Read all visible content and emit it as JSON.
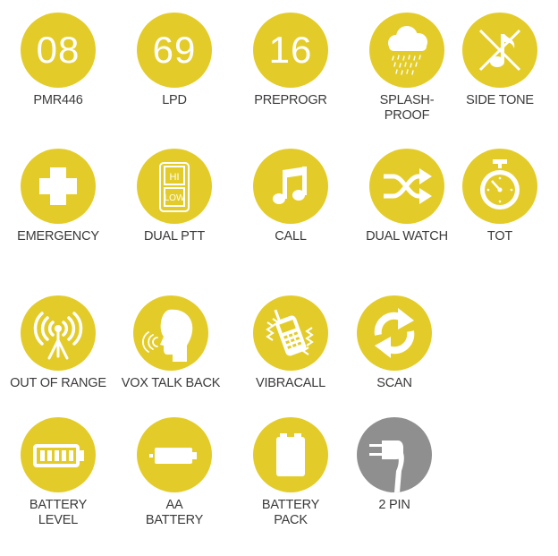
{
  "colors": {
    "accent": "#e3cc2a",
    "neutral": "#8f8f90",
    "icon": "#ffffff",
    "label": "#3a3a3a"
  },
  "features": [
    {
      "id": "pmr446",
      "number": "08",
      "label_lines": [
        "PMR446"
      ]
    },
    {
      "id": "lpd",
      "number": "69",
      "label_lines": [
        "LPD"
      ]
    },
    {
      "id": "preprogr",
      "number": "16",
      "label_lines": [
        "PREPROGR"
      ]
    },
    {
      "id": "splash-proof",
      "icon": "rain-cloud-icon",
      "label_lines": [
        "SPLASH-",
        "PROOF"
      ]
    },
    {
      "id": "side-tone",
      "icon": "muted-note-icon",
      "label_lines": [
        "SIDE TONE"
      ]
    },
    {
      "id": "emergency",
      "icon": "cross-icon",
      "label_lines": [
        "EMERGENCY"
      ]
    },
    {
      "id": "dual-ptt",
      "icon": "hi-low-switch-icon",
      "switch_top": "HI",
      "switch_bottom": "LOW",
      "label_lines": [
        "DUAL PTT"
      ]
    },
    {
      "id": "call",
      "icon": "music-note-icon",
      "label_lines": [
        "CALL"
      ]
    },
    {
      "id": "dual-watch",
      "icon": "shuffle-icon",
      "label_lines": [
        "DUAL WATCH"
      ]
    },
    {
      "id": "tot",
      "icon": "stopwatch-icon",
      "label_lines": [
        "TOT"
      ]
    },
    {
      "id": "out-of-range",
      "icon": "antenna-icon",
      "label_lines": [
        "OUT OF RANGE"
      ]
    },
    {
      "id": "vox-talk-back",
      "icon": "speaking-head-icon",
      "label_lines": [
        "VOX TALK BACK"
      ]
    },
    {
      "id": "vibracall",
      "icon": "vibrating-phone-icon",
      "label_lines": [
        "VIBRACALL"
      ]
    },
    {
      "id": "scan",
      "icon": "refresh-arrows-icon",
      "label_lines": [
        "SCAN"
      ]
    },
    {
      "id": "battery-level",
      "icon": "battery-level-icon",
      "label_lines": [
        "BATTERY",
        "LEVEL"
      ]
    },
    {
      "id": "aa-battery",
      "icon": "aa-battery-icon",
      "label_lines": [
        "AA",
        "BATTERY"
      ]
    },
    {
      "id": "battery-pack",
      "icon": "battery-pack-icon",
      "label_lines": [
        "BATTERY",
        "PACK"
      ]
    },
    {
      "id": "2-pin",
      "icon": "two-pin-plug-icon",
      "label_lines": [
        "2 PIN"
      ]
    }
  ]
}
